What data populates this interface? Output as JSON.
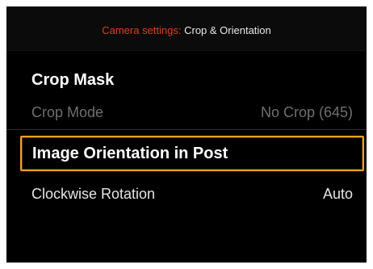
{
  "header": {
    "prefix": "Camera settings:",
    "title": " Crop & Orientation"
  },
  "sections": {
    "crop_mask": {
      "heading": "Crop Mask",
      "crop_mode": {
        "label": "Crop Mode",
        "value": "No Crop (645)"
      }
    },
    "image_orientation": {
      "heading": "Image Orientation in Post",
      "clockwise_rotation": {
        "label": "Clockwise Rotation",
        "value": "Auto"
      }
    }
  },
  "colors": {
    "accent_red": "#e23c1e",
    "selection_orange": "#f0a020",
    "background": "#000000"
  }
}
